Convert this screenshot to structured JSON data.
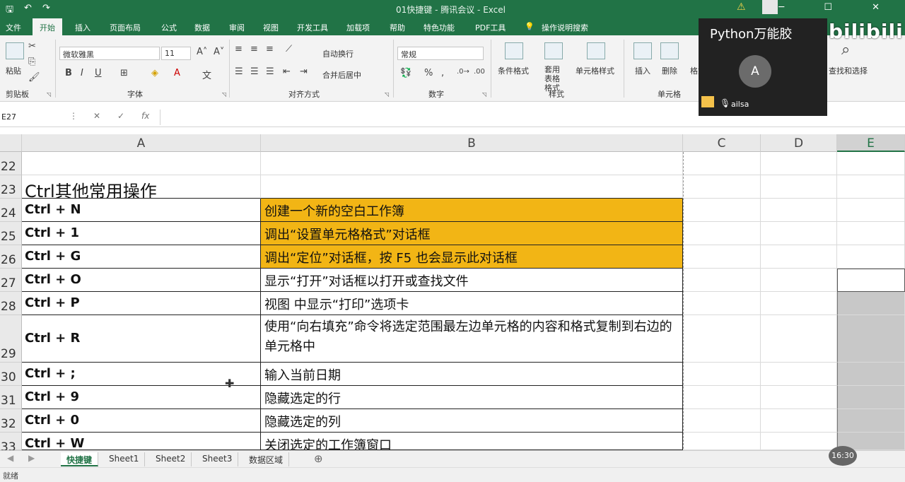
{
  "titlebar": {
    "doc_title": "01快捷键 - 腾讯会议 - Excel",
    "save_icon": "save-icon",
    "undo_icon": "undo-icon",
    "redo_icon": "redo-icon"
  },
  "tabs": [
    "文件",
    "开始",
    "插入",
    "页面布局",
    "公式",
    "数据",
    "审阅",
    "视图",
    "开发工具",
    "加载项",
    "帮助",
    "特色功能",
    "PDF工具",
    "操作说明搜索"
  ],
  "ribbon": {
    "clipboard": {
      "label": "剪贴板",
      "paste": "粘贴"
    },
    "font": {
      "label": "字体",
      "font_name": "微软雅黑",
      "font_size": "11",
      "bold": "B",
      "italic": "I",
      "underline": "U"
    },
    "alignment": {
      "label": "对齐方式",
      "wrap": "自动换行",
      "merge": "合并后居中"
    },
    "number": {
      "label": "数字",
      "format": "常规",
      "percent": "%",
      "comma": ","
    },
    "styles": {
      "label": "样式",
      "conditional": "条件格式",
      "table": "套用表格格式",
      "cell_styles": "单元格样式"
    },
    "cells": {
      "label": "单元格",
      "insert": "插入",
      "delete": "删除",
      "format": "格式"
    },
    "editing": {
      "find": "查找和选择"
    }
  },
  "formula_bar": {
    "name_box": "E27",
    "fx": "fx",
    "value": ""
  },
  "columns": [
    "A",
    "B",
    "C",
    "D",
    "E"
  ],
  "rows": [
    {
      "num": "22",
      "a": "",
      "b": "",
      "hl": false
    },
    {
      "num": "23",
      "a": "Ctrl其他常用操作",
      "b": "",
      "hl": false
    },
    {
      "num": "24",
      "a": "Ctrl + N",
      "b": "创建一个新的空白工作簿",
      "hl": true
    },
    {
      "num": "25",
      "a": "Ctrl + 1",
      "b": "调出“设置单元格格式”对话框",
      "hl": true
    },
    {
      "num": "26",
      "a": "Ctrl + G",
      "b": "调出“定位”对话框，按 F5 也会显示此对话框",
      "hl": true
    },
    {
      "num": "27",
      "a": "Ctrl + O",
      "b": "显示“打开”对话框以打开或查找文件",
      "hl": false
    },
    {
      "num": "28",
      "a": "Ctrl + P",
      "b": "视图 中显示“打印”选项卡",
      "hl": false
    },
    {
      "num": "29",
      "a": "Ctrl + R",
      "b": "使用“向右填充”命令将选定范围最左边单元格的内容和格式复制到右边的单元格中",
      "hl": false
    },
    {
      "num": "30",
      "a": "Ctrl + ;",
      "b": "输入当前日期",
      "hl": false
    },
    {
      "num": "31",
      "a": "Ctrl + 9",
      "b": "隐藏选定的行",
      "hl": false
    },
    {
      "num": "32",
      "a": "Ctrl + 0",
      "b": "隐藏选定的列",
      "hl": false
    },
    {
      "num": "33",
      "a": "Ctrl + W",
      "b": "关闭选定的工作簿窗口",
      "hl": false
    }
  ],
  "sheets": [
    "快捷键",
    "Sheet1",
    "Sheet2",
    "Sheet3",
    "数据区域"
  ],
  "status": {
    "ready": "就绪"
  },
  "overlay": {
    "title": "Python万能胶",
    "avatar_letter": "A",
    "username": "ailsa"
  },
  "watermark": "bilibili",
  "timer": "16:30"
}
